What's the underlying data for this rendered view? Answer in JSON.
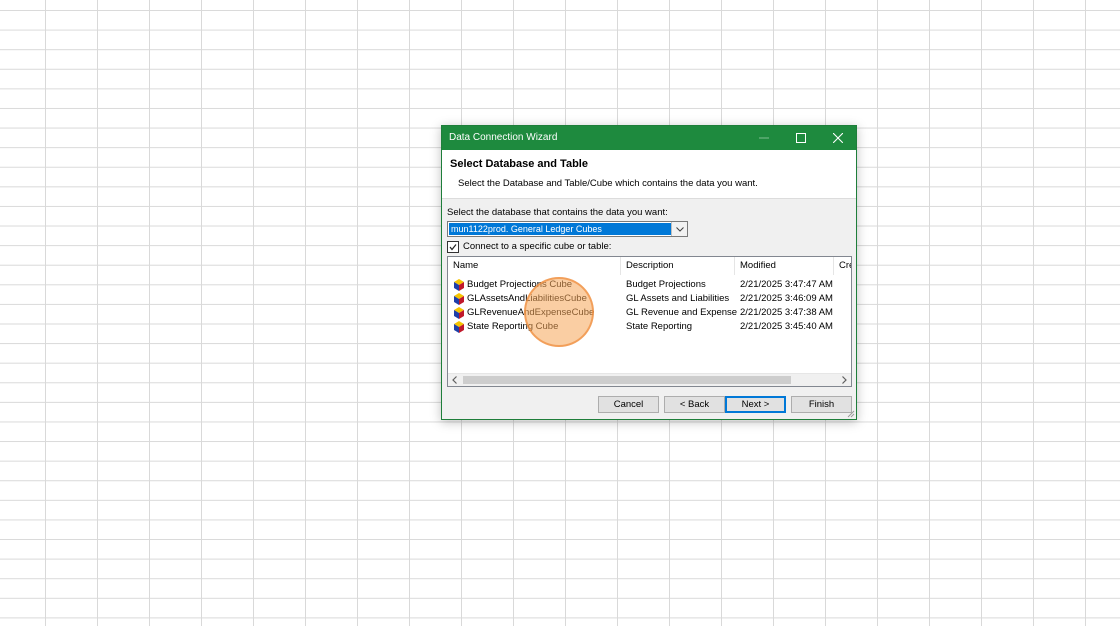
{
  "dialog": {
    "title": "Data Connection Wizard",
    "header_title": "Select Database and Table",
    "header_subtitle": "Select the Database and Table/Cube which contains the data you want.",
    "database_label": "Select the database that contains the data you want:",
    "database_value": "mun1122prod. General Ledger Cubes",
    "checkbox_label": "Connect to a specific cube or table:",
    "checkbox_checked": true,
    "columns": [
      "Name",
      "Description",
      "Modified",
      "Cre"
    ],
    "rows": [
      {
        "name": "Budget Projections Cube",
        "description": "Budget Projections",
        "modified": "2/21/2025 3:47:47 AM"
      },
      {
        "name": "GLAssetsAndLiabilitiesCube",
        "description": "GL Assets and Liabilities",
        "modified": "2/21/2025 3:46:09 AM"
      },
      {
        "name": "GLRevenueAndExpenseCube",
        "description": "GL Revenue and Expense",
        "modified": "2/21/2025 3:47:38 AM"
      },
      {
        "name": "State Reporting Cube",
        "description": "State Reporting",
        "modified": "2/21/2025 3:45:40 AM"
      }
    ],
    "buttons": {
      "cancel": "Cancel",
      "back": "< Back",
      "next": "Next >",
      "finish": "Finish"
    }
  },
  "icons": {
    "minimize": "minimize-icon",
    "maximize": "maximize-icon",
    "close": "close-icon",
    "cube": "cube-icon",
    "dropdown": "chevron-down-icon"
  },
  "colors": {
    "titlebar": "#1e8a3e",
    "selection": "#0078d7",
    "click_highlight": "#f6a558"
  }
}
